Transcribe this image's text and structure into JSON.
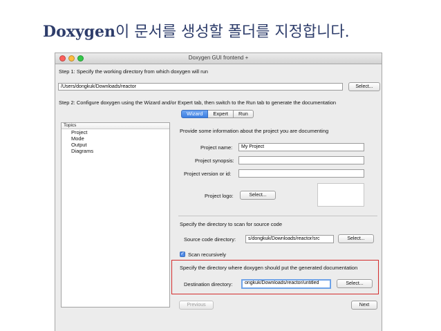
{
  "slide": {
    "title_latin": "Doxygen",
    "title_korean": "이 문서를 생성할 폴더를 지정합니다."
  },
  "window": {
    "title": "Doxygen GUI frontend +",
    "step1": "Step 1: Specify the working directory from which doxygen will run",
    "working_dir": "/Users/dongkuk/Downloads/reactor",
    "select_label": "Select...",
    "step2": "Step 2: Configure doxygen using the Wizard and/or Expert tab, then switch to the Run tab to generate the documentation",
    "tabs": [
      {
        "label": "Wizard"
      },
      {
        "label": "Expert"
      },
      {
        "label": "Run"
      }
    ]
  },
  "topics": {
    "header": "Topics",
    "items": [
      "Project",
      "Mode",
      "Output",
      "Diagrams"
    ]
  },
  "project": {
    "intro": "Provide some information about the project you are documenting",
    "name_label": "Project name:",
    "name_value": "My Project",
    "synopsis_label": "Project synopsis:",
    "synopsis_value": "",
    "version_label": "Project version or id:",
    "version_value": "",
    "logo_label": "Project logo:",
    "logo_button": "Select..."
  },
  "source": {
    "header": "Specify the directory to scan for source code",
    "dir_label": "Source code directory:",
    "dir_value": "s/dongkuk/Downloads/reactor/src",
    "select_label": "Select...",
    "recursive_label": "Scan recursively",
    "recursive_checked": true
  },
  "destination": {
    "header": "Specify the directory where doxygen should put the generated documentation",
    "dir_label": "Destination directory:",
    "dir_value": "ongkuk/Downloads/reactor/untitled",
    "select_label": "Select..."
  },
  "nav": {
    "previous": "Previous",
    "next": "Next"
  },
  "colors": {
    "title": "#2e3d6b",
    "highlight": "#d32b2b",
    "active_tab": "#3c7fe1"
  }
}
